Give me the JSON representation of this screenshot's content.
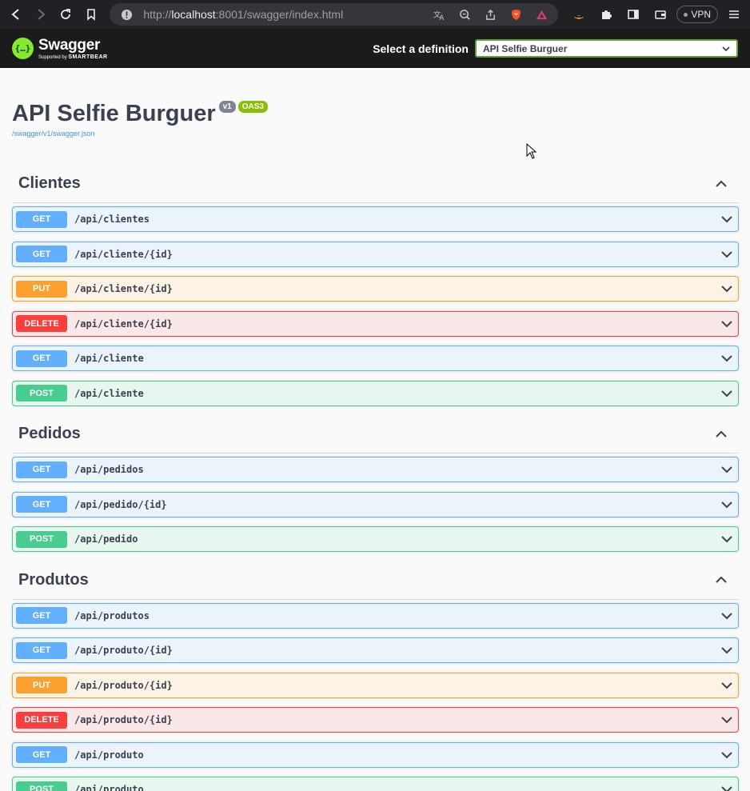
{
  "browser": {
    "url_scheme_host": "http://",
    "url_host": "localhost",
    "url_rest": ":8001/swagger/index.html",
    "vpn_label": "VPN"
  },
  "topbar": {
    "logo_name": "Swagger",
    "logo_sub_prefix": "Supported by ",
    "logo_sub_brand": "SMARTBEAR",
    "definition_label": "Select a definition",
    "definition_value": "API Selfie Burguer"
  },
  "info": {
    "title": "API Selfie Burguer",
    "version_badge": "v1",
    "oas_badge": "OAS3",
    "spec_link": "/swagger/v1/swagger.json"
  },
  "tags": [
    {
      "name": "Clientes",
      "ops": [
        {
          "method": "GET",
          "path": "/api/clientes"
        },
        {
          "method": "GET",
          "path": "/api/cliente/{id}"
        },
        {
          "method": "PUT",
          "path": "/api/cliente/{id}"
        },
        {
          "method": "DELETE",
          "path": "/api/cliente/{id}"
        },
        {
          "method": "GET",
          "path": "/api/cliente"
        },
        {
          "method": "POST",
          "path": "/api/cliente"
        }
      ]
    },
    {
      "name": "Pedidos",
      "ops": [
        {
          "method": "GET",
          "path": "/api/pedidos"
        },
        {
          "method": "GET",
          "path": "/api/pedido/{id}"
        },
        {
          "method": "POST",
          "path": "/api/pedido"
        }
      ]
    },
    {
      "name": "Produtos",
      "ops": [
        {
          "method": "GET",
          "path": "/api/produtos"
        },
        {
          "method": "GET",
          "path": "/api/produto/{id}"
        },
        {
          "method": "PUT",
          "path": "/api/produto/{id}"
        },
        {
          "method": "DELETE",
          "path": "/api/produto/{id}"
        },
        {
          "method": "GET",
          "path": "/api/produto"
        },
        {
          "method": "POST",
          "path": "/api/produto"
        }
      ]
    }
  ],
  "colors": {
    "get": "#61affe",
    "put": "#fca130",
    "delete": "#f93e3e",
    "post": "#49cc90",
    "swagger_green": "#85ea2d"
  }
}
